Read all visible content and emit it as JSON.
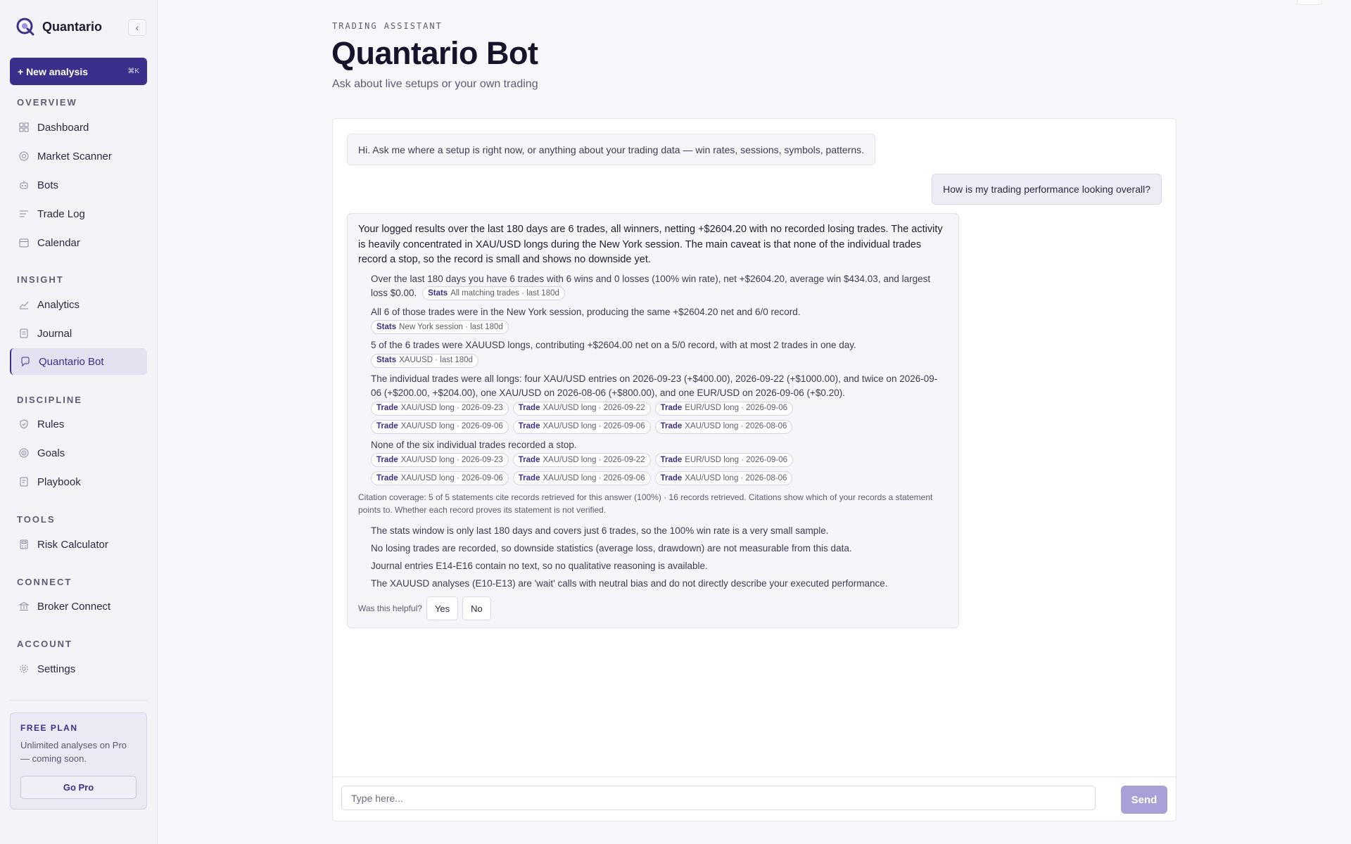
{
  "sidebar": {
    "brand": "Quantario",
    "new_analysis": {
      "label": "+ New analysis",
      "shortcut": "⌘K"
    },
    "sections": {
      "overview": "OVERVIEW",
      "insight": "INSIGHT",
      "discipline": "DISCIPLINE",
      "tools": "TOOLS",
      "connect": "CONNECT",
      "account": "ACCOUNT"
    },
    "items": {
      "dashboard": "Dashboard",
      "market_scanner": "Market Scanner",
      "bots": "Bots",
      "trade_log": "Trade Log",
      "calendar": "Calendar",
      "analytics": "Analytics",
      "journal": "Journal",
      "quantario_bot": "Quantario Bot",
      "rules": "Rules",
      "goals": "Goals",
      "playbook": "Playbook",
      "risk_calculator": "Risk Calculator",
      "broker_connect": "Broker Connect",
      "settings": "Settings"
    },
    "active_item": "Quantario Bot",
    "plan": {
      "title": "FREE PLAN",
      "text": "Unlimited analyses on Pro — coming soon.",
      "button": "Go Pro"
    }
  },
  "header": {
    "eyebrow": "TRADING ASSISTANT",
    "title": "Quantario Bot",
    "subtitle": "Ask about live setups or your own trading"
  },
  "chat": {
    "greeting": "Hi. Ask me where a setup is right now, or anything about your trading data — win rates, sessions, symbols, patterns.",
    "user_message": "How is my trading performance looking overall?",
    "bot": {
      "lead": "Your logged results over the last 180 days are 6 trades, all winners, netting +$2604.20 with no recorded losing trades. The activity is heavily concentrated in XAU/USD longs during the New York session. The main caveat is that none of the individual trades record a stop, so the record is small and shows no downside yet.",
      "claims": [
        {
          "text": "Over the last 180 days you have 6 trades with 6 wins and 0 losses (100% win rate), net +$2604.20, average win $434.03, and largest loss $0.00.",
          "chips": [
            {
              "kind": "Stats",
              "label": "All matching trades · last 180d"
            }
          ]
        },
        {
          "text": "All 6 of those trades were in the New York session, producing the same +$2604.20 net and 6/0 record.",
          "chips": [
            {
              "kind": "Stats",
              "label": "New York session · last 180d"
            }
          ]
        },
        {
          "text": "5 of the 6 trades were XAUUSD longs, contributing +$2604.00 net on a 5/0 record, with at most 2 trades in one day.",
          "chips": [
            {
              "kind": "Stats",
              "label": "XAUUSD · last 180d"
            }
          ]
        },
        {
          "text": "The individual trades were all longs: four XAU/USD entries on 2026-09-23 (+$400.00), 2026-09-22 (+$1000.00), and twice on 2026-09-06 (+$200.00, +$204.00), one XAU/USD on 2026-08-06 (+$800.00), and one EUR/USD on 2026-09-06 (+$0.20).",
          "chips": [
            {
              "kind": "Trade",
              "label": "XAU/USD long · 2026-09-23"
            },
            {
              "kind": "Trade",
              "label": "XAU/USD long · 2026-09-22"
            },
            {
              "kind": "Trade",
              "label": "EUR/USD long · 2026-09-06"
            },
            {
              "kind": "Trade",
              "label": "XAU/USD long · 2026-09-06"
            },
            {
              "kind": "Trade",
              "label": "XAU/USD long · 2026-09-06"
            },
            {
              "kind": "Trade",
              "label": "XAU/USD long · 2026-08-06"
            }
          ]
        },
        {
          "text": "None of the six individual trades recorded a stop.",
          "chips": [
            {
              "kind": "Trade",
              "label": "XAU/USD long · 2026-09-23"
            },
            {
              "kind": "Trade",
              "label": "XAU/USD long · 2026-09-22"
            },
            {
              "kind": "Trade",
              "label": "EUR/USD long · 2026-09-06"
            },
            {
              "kind": "Trade",
              "label": "XAU/USD long · 2026-09-06"
            },
            {
              "kind": "Trade",
              "label": "XAU/USD long · 2026-09-06"
            },
            {
              "kind": "Trade",
              "label": "XAU/USD long · 2026-08-06"
            }
          ]
        }
      ],
      "coverage": "Citation coverage: 5 of 5 statements cite records retrieved for this answer (100%) · 16 records retrieved. Citations show which of your records a statement points to. Whether each record proves its statement is not verified.",
      "caveats": [
        "The stats window is only last 180 days and covers just 6 trades, so the 100% win rate is a very small sample.",
        "No losing trades are recorded, so downside statistics (average loss, drawdown) are not measurable from this data.",
        "Journal entries E14-E16 contain no text, so no qualitative reasoning is available.",
        "The XAUUSD analyses (E10-E13) are 'wait' calls with neutral bias and do not directly describe your executed performance."
      ],
      "feedback": {
        "question": "Was this helpful?",
        "yes": "Yes",
        "no": "No"
      }
    },
    "composer": {
      "placeholder": "Type here...",
      "value": "",
      "send": "Send"
    }
  },
  "colors": {
    "accent": "#3a2f8a",
    "send_disabled": "#a8a1d8",
    "sidebar_bg": "#f4f3f8"
  },
  "icons": {
    "brand": "quantario-logo-icon",
    "collapse": "chevron-left-icon",
    "dashboard": "grid-icon",
    "market_scanner": "radar-icon",
    "bots": "robot-icon",
    "trade_log": "list-icon",
    "calendar": "calendar-icon",
    "analytics": "line-chart-icon",
    "journal": "notebook-icon",
    "quantario_bot": "chat-bubble-icon",
    "rules": "shield-check-icon",
    "goals": "target-icon",
    "playbook": "book-icon",
    "risk_calculator": "calculator-icon",
    "broker_connect": "bank-icon",
    "settings": "gear-icon"
  }
}
